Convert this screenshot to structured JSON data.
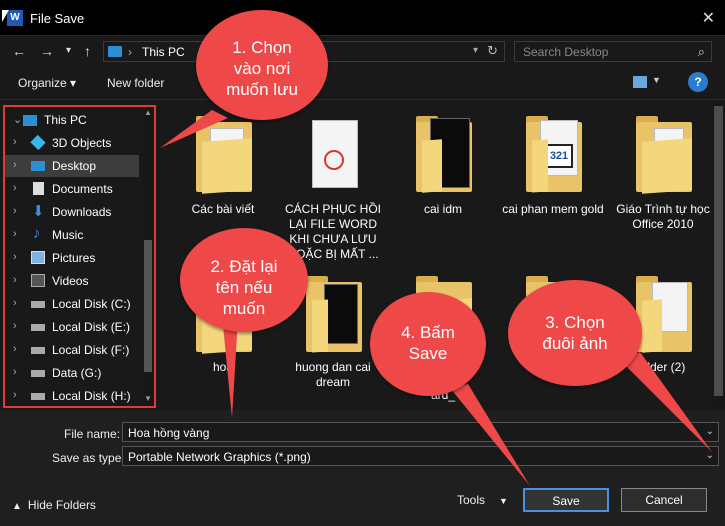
{
  "window": {
    "title": "File Save",
    "app_icon": "W"
  },
  "address": {
    "location": "This PC",
    "search_placeholder": "Search Desktop"
  },
  "toolbar": {
    "organize": "Organize ▾",
    "new_folder": "New folder"
  },
  "nav": [
    {
      "label": "This PC",
      "expanded": true
    },
    {
      "label": "3D Objects"
    },
    {
      "label": "Desktop",
      "selected": true
    },
    {
      "label": "Documents"
    },
    {
      "label": "Downloads"
    },
    {
      "label": "Music"
    },
    {
      "label": "Pictures"
    },
    {
      "label": "Videos"
    },
    {
      "label": "Local Disk (C:)"
    },
    {
      "label": "Local Disk (E:)"
    },
    {
      "label": "Local Disk (F:)"
    },
    {
      "label": "Data (G:)"
    },
    {
      "label": "Local Disk (H:)"
    }
  ],
  "files": [
    {
      "name": "Các bài viết"
    },
    {
      "name": "CÁCH PHỤC HỒI LẠI FILE WORD KHI CHƯA LƯU HOẶC BỊ MẤT ..."
    },
    {
      "name": "cai idm"
    },
    {
      "name": "cai phan mem gold"
    },
    {
      "name": "Giáo Trình tự học Office 2010"
    },
    {
      "name": "hoa"
    },
    {
      "name": "huong dan cai dream"
    },
    {
      "name": "ard_"
    },
    {
      "name": ""
    },
    {
      "name": "older (2)"
    }
  ],
  "form": {
    "file_name_label": "File name:",
    "file_name": "Hoa hồng vàng",
    "type_label": "Save as type:",
    "type": "Portable Network Graphics (*.png)"
  },
  "footer": {
    "hide_folders": "Hide Folders",
    "tools": "Tools",
    "save": "Save",
    "cancel": "Cancel"
  },
  "callouts": {
    "c1": [
      "1. Chọn",
      "vào nơi",
      "muốn lưu"
    ],
    "c2": [
      "2. Đặt lại",
      "tên nếu",
      "muốn"
    ],
    "c3": [
      "3. Chọn",
      "đuôi ảnh"
    ],
    "c4": [
      "4. Bấm",
      "Save"
    ]
  },
  "colors": {
    "accent": "#4a90e2",
    "callout": "#ef4848",
    "highlight_border": "#e03a3a"
  }
}
